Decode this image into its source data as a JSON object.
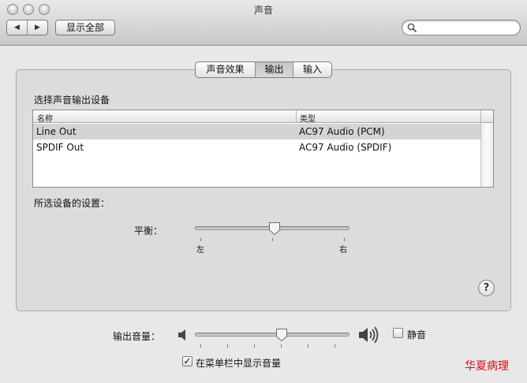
{
  "window": {
    "title": "声音"
  },
  "toolbar": {
    "back_glyph": "◀",
    "forward_glyph": "▶",
    "show_all_label": "显示全部",
    "search_value": "",
    "search_placeholder": ""
  },
  "tabs": [
    {
      "label": "声音效果",
      "selected": false
    },
    {
      "label": "输出",
      "selected": true
    },
    {
      "label": "输入",
      "selected": false
    }
  ],
  "output": {
    "section_title": "选择声音输出设备",
    "table": {
      "columns": [
        "名称",
        "类型"
      ],
      "rows": [
        {
          "name": "Line Out",
          "type": "AC97 Audio (PCM)",
          "selected": true
        },
        {
          "name": "SPDIF Out",
          "type": "AC97 Audio (SPDIF)",
          "selected": false
        }
      ]
    },
    "device_settings_title": "所选设备的设置：",
    "balance": {
      "label": "平衡：",
      "left_label": "左",
      "right_label": "右",
      "value": 0.5
    }
  },
  "help_label": "?",
  "volume": {
    "label": "输出音量：",
    "value": 0.55,
    "mute_label": "静音",
    "muted": false
  },
  "menubar_checkbox": {
    "label": "在菜单栏中显示音量",
    "checked": true,
    "check_glyph": "✓"
  },
  "watermark": "华夏病理",
  "colors": {
    "selected_row": "#d4d4d4",
    "watermark": "#d0101a"
  }
}
